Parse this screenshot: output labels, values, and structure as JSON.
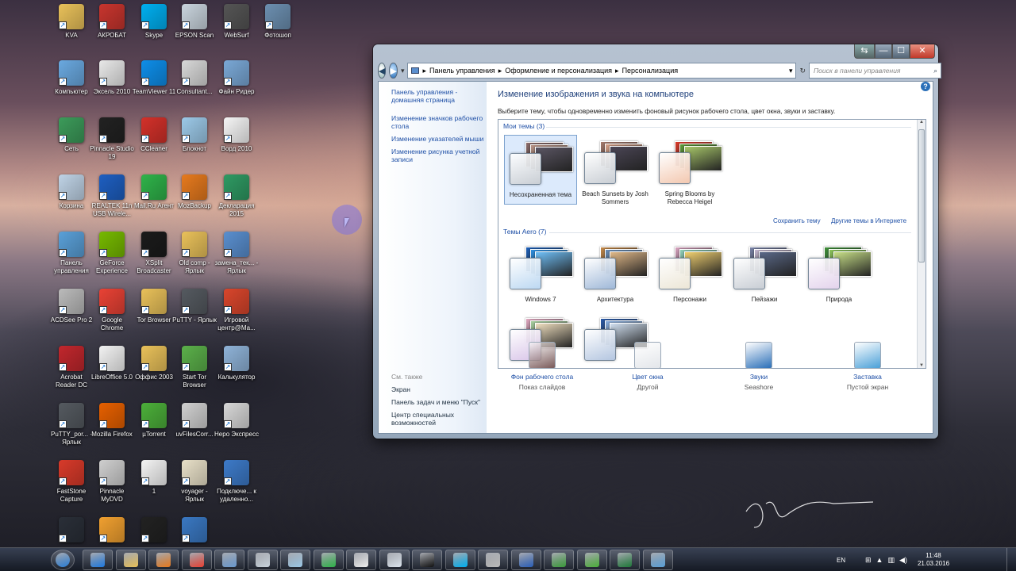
{
  "desktop": {
    "columns": [
      [
        {
          "label": "KVA",
          "icon": "folder-icon",
          "color": "#e9c15a"
        },
        {
          "label": "Компьютер",
          "icon": "computer-icon",
          "color": "#6aa9e0"
        },
        {
          "label": "Сеть",
          "icon": "network-icon",
          "color": "#3c9b5a"
        },
        {
          "label": "Корзина",
          "icon": "recycle-bin-icon",
          "color": "#bfd3e6"
        },
        {
          "label": "Панель управления",
          "icon": "control-panel-icon",
          "color": "#5aa0d8"
        },
        {
          "label": "ACDSee Pro 2",
          "icon": "acdsee-icon",
          "color": "#bbbbbb"
        },
        {
          "label": "Acrobat Reader DC",
          "icon": "acrobat-icon",
          "color": "#c1272d"
        },
        {
          "label": "PuTTY_por... - Ярлык",
          "icon": "putty-icon",
          "color": "#555a60"
        },
        {
          "label": "FastStone Capture",
          "icon": "faststone-icon",
          "color": "#d83a2a"
        },
        {
          "label": "",
          "icon": "sb-icon",
          "color": "#2a2f38"
        }
      ],
      [
        {
          "label": "АКРОБАТ",
          "icon": "acrobat-pdf-icon",
          "color": "#c8352e"
        },
        {
          "label": "Эксель 2010",
          "icon": "spreadsheet-icon",
          "color": "#e8e8e8"
        },
        {
          "label": "Pinnacle Studio 19",
          "icon": "pinnacle-icon",
          "color": "#222"
        },
        {
          "label": "REALTEK 11n USB Wirele...",
          "icon": "realtek-icon",
          "color": "#1e5fc1"
        },
        {
          "label": "GeForce Experience",
          "icon": "geforce-icon",
          "color": "#76b900"
        },
        {
          "label": "Google Chrome",
          "icon": "chrome-icon",
          "color": "#e94235"
        },
        {
          "label": "LibreOffice 5.0",
          "icon": "libreoffice-icon",
          "color": "#f2f2f2"
        },
        {
          "label": "Mozilla Firefox",
          "icon": "firefox-icon",
          "color": "#e66000"
        },
        {
          "label": "Pinnacle MyDVD",
          "icon": "mydvd-icon",
          "color": "#cfcfcf"
        },
        {
          "label": "",
          "icon": "artweaver-icon",
          "color": "#f0a030"
        }
      ],
      [
        {
          "label": "Skype",
          "icon": "skype-icon",
          "color": "#00aff0"
        },
        {
          "label": "TeamViewer 11",
          "icon": "teamviewer-icon",
          "color": "#0e8ee9"
        },
        {
          "label": "CCleaner",
          "icon": "ccleaner-icon",
          "color": "#d3312a"
        },
        {
          "label": "Mail.Ru Агент",
          "icon": "mailru-agent-icon",
          "color": "#2fb34a"
        },
        {
          "label": "XSplit Broadcaster",
          "icon": "xsplit-icon",
          "color": "#1b1b1b"
        },
        {
          "label": "Tor Browser",
          "icon": "tor-folder-icon",
          "color": "#e9c15a"
        },
        {
          "label": "Оффис 2003",
          "icon": "folder-icon",
          "color": "#e9c15a"
        },
        {
          "label": "µTorrent",
          "icon": "utorrent-icon",
          "color": "#4caf3a"
        },
        {
          "label": "1",
          "icon": "document-icon",
          "color": "#f4f4f4"
        },
        {
          "label": "",
          "icon": "wordpad-icon",
          "color": "#222"
        }
      ],
      [
        {
          "label": "EPSON Scan",
          "icon": "scanner-icon",
          "color": "#c9d4dd"
        },
        {
          "label": "Consultant...",
          "icon": "consultant-icon",
          "color": "#d8d8d8"
        },
        {
          "label": "Блокнот",
          "icon": "notepad-icon",
          "color": "#9cc9e8"
        },
        {
          "label": "MozBackup",
          "icon": "mozbackup-icon",
          "color": "#e67a1e"
        },
        {
          "label": "Old comp - Ярлык",
          "icon": "folder-icon",
          "color": "#e9c15a"
        },
        {
          "label": "PuTTY - Ярлык",
          "icon": "putty-icon",
          "color": "#555a60"
        },
        {
          "label": "Start Tor Browser",
          "icon": "tor-icon",
          "color": "#5bb04a"
        },
        {
          "label": "uvFilesCorr...",
          "icon": "binoculars-icon",
          "color": "#d0d0d0"
        },
        {
          "label": "voyager - Ярлык",
          "icon": "compass-icon",
          "color": "#e8e0c8"
        },
        {
          "label": "",
          "icon": "media-icon",
          "color": "#3a78c2"
        }
      ],
      [
        {
          "label": "WebSurf",
          "icon": "websurf-icon",
          "color": "#555"
        },
        {
          "label": "Файн Ридер",
          "icon": "finereader-icon",
          "color": "#7aa8d6"
        },
        {
          "label": "Ворд 2010",
          "icon": "word-icon",
          "color": "#f5f5f5"
        },
        {
          "label": "Декларация 2015",
          "icon": "declaration-icon",
          "color": "#2f9a63"
        },
        {
          "label": "замена_тек... - Ярлык",
          "icon": "network-share-icon",
          "color": "#5a8fcf"
        },
        {
          "label": "Игровой центр@Ма...",
          "icon": "game-center-icon",
          "color": "#d9462c"
        },
        {
          "label": "Калькулятор",
          "icon": "calculator-icon",
          "color": "#8fb3d8"
        },
        {
          "label": "Неро Экспресс",
          "icon": "nero-icon",
          "color": "#d7d7d7"
        },
        {
          "label": "Подключе... к удаленно...",
          "icon": "remote-desktop-icon",
          "color": "#3d7ac8"
        }
      ],
      [
        {
          "label": "Фотошоп",
          "icon": "photoshop-icon",
          "color": "#6c8fb0"
        }
      ]
    ]
  },
  "window": {
    "controls": {
      "restore": "⇆",
      "minimize": "—",
      "maximize": "☐",
      "close": "✕"
    },
    "breadcrumb": [
      "Панель управления",
      "Оформление и персонализация",
      "Персонализация"
    ],
    "search_placeholder": "Поиск в панели управления",
    "left_nav": {
      "home_link": "Панель управления - домашняя страница",
      "links": [
        "Изменение значков рабочего стола",
        "Изменение указателей мыши",
        "Изменение рисунка учетной записи"
      ],
      "see_also_title": "См. также",
      "see_also": [
        "Экран",
        "Панель задач и меню \"Пуск\"",
        "Центр специальных возможностей"
      ]
    },
    "main": {
      "title": "Изменение изображения и звука на компьютере",
      "description": "Выберите тему, чтобы одновременно изменить фоновый рисунок рабочего стола, цвет окна, звуки и заставку.",
      "my_themes_header": "Мои темы (3)",
      "my_themes": [
        {
          "name": "Несохраненная тема",
          "selected": true,
          "swatch": "#c9ced4",
          "tones": [
            "#8a6b6a",
            "#b99486",
            "#5b5664"
          ]
        },
        {
          "name": "Beach Sunsets by Josh Sommers",
          "selected": false,
          "swatch": "#c9ced4",
          "tones": [
            "#a67b6d",
            "#d9a38a",
            "#4b4656"
          ]
        },
        {
          "name": "Spring Blooms by Rebecca Heigel",
          "selected": false,
          "swatch": "#f3c8b0",
          "tones": [
            "#d93b2a",
            "#5e9b3a",
            "#a8c76a"
          ]
        }
      ],
      "save_theme": "Сохранить тему",
      "more_themes": "Другие темы в Интернете",
      "aero_header": "Темы Aero (7)",
      "aero_themes": [
        {
          "name": "Windows 7",
          "swatch": "#bcd8f2",
          "tones": [
            "#1d5fb8",
            "#2d8fe0",
            "#6fc0f8"
          ]
        },
        {
          "name": "Архитектура",
          "swatch": "#9fb8d8",
          "tones": [
            "#c58a4a",
            "#6b8fb8",
            "#e0b888"
          ]
        },
        {
          "name": "Персонажи",
          "swatch": "#ece6d6",
          "tones": [
            "#d8a4c0",
            "#8fd0b8",
            "#f0d070"
          ]
        },
        {
          "name": "Пейзажи",
          "swatch": "#c8cdd4",
          "tones": [
            "#7a84a8",
            "#c4b8d0",
            "#5a6888"
          ]
        },
        {
          "name": "Природа",
          "swatch": "#e3d3ec",
          "tones": [
            "#3f8f3a",
            "#8bc45a",
            "#c8e088"
          ]
        },
        {
          "name": "",
          "swatch": "#d8c4e8",
          "tones": [
            "#e0a8c0",
            "#a8d0a0",
            "#f0e0c0"
          ]
        },
        {
          "name": "",
          "swatch": "#b4c6e0",
          "tones": [
            "#2a5aa8",
            "#8ab0e0",
            "#d0dff0"
          ]
        }
      ],
      "bottom": [
        {
          "label": "Фон рабочего стола",
          "sub": "Показ слайдов",
          "icon": "desktop-background-icon",
          "color": "#7a5a5a"
        },
        {
          "label": "Цвет окна",
          "sub": "Другой",
          "icon": "window-color-icon",
          "color": "#e3e6ea"
        },
        {
          "label": "Звуки",
          "sub": "Seashore",
          "icon": "sounds-icon",
          "color": "#2a6fb8"
        },
        {
          "label": "Заставка",
          "sub": "Пустой экран",
          "icon": "screensaver-icon",
          "color": "#4aa0d8"
        }
      ]
    }
  },
  "taskbar": {
    "items": [
      {
        "icon": "start-orb-icon",
        "color": "#2a7fd8"
      },
      {
        "icon": "ie-icon",
        "color": "#1f7ae0"
      },
      {
        "icon": "explorer-folder-icon",
        "color": "#e9c15a"
      },
      {
        "icon": "media-player-icon",
        "color": "#e87a1e"
      },
      {
        "icon": "chrome-icon",
        "color": "#e94235"
      },
      {
        "icon": "photo-viewer-icon",
        "color": "#6a9ad0"
      },
      {
        "icon": "scanner-icon",
        "color": "#c9d4dd"
      },
      {
        "icon": "notepad-icon",
        "color": "#9cc9e8"
      },
      {
        "icon": "mailru-agent-icon",
        "color": "#2fb34a"
      },
      {
        "icon": "play-icon",
        "color": "#f0f0f0"
      },
      {
        "icon": "calculator-icon",
        "color": "#dde6ef"
      },
      {
        "icon": "cmd-icon",
        "color": "#111"
      },
      {
        "icon": "skype-icon",
        "color": "#00aff0"
      },
      {
        "icon": "acdsee-icon",
        "color": "#bbbbbb"
      },
      {
        "icon": "word-icon",
        "color": "#2b5fb8"
      },
      {
        "icon": "spreadsheet-chart-icon",
        "color": "#3b9a3b"
      },
      {
        "icon": "utorrent-icon",
        "color": "#4caf3a"
      },
      {
        "icon": "excel-icon",
        "color": "#1f7a3a"
      },
      {
        "icon": "control-panel-icon",
        "color": "#5aa0d8"
      }
    ],
    "lang": "EN",
    "time": "11:48",
    "date": "21.03.2016"
  }
}
